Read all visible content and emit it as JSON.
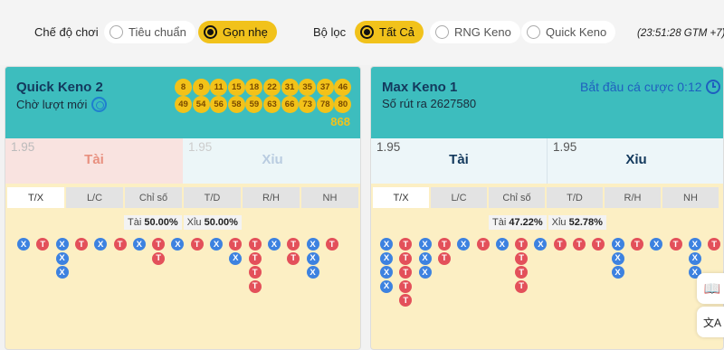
{
  "controls": {
    "mode_label": "Chế độ chơi",
    "modes": [
      {
        "label": "Tiêu chuẩn",
        "selected": false
      },
      {
        "label": "Gọn nhẹ",
        "selected": true
      }
    ],
    "filter_label": "Bộ lọc",
    "filters": [
      {
        "label": "Tất Cả",
        "selected": true
      },
      {
        "label": "RNG Keno",
        "selected": false
      },
      {
        "label": "Quick Keno",
        "selected": false
      }
    ],
    "clock": "(23:51:28 GTM +7)"
  },
  "cards": [
    {
      "title": "Quick Keno 2",
      "subtitle": "Chờ lượt mới",
      "balls": [
        "8",
        "9",
        "11",
        "15",
        "18",
        "22",
        "31",
        "35",
        "37",
        "46",
        "49",
        "54",
        "56",
        "58",
        "59",
        "63",
        "66",
        "73",
        "78",
        "80"
      ],
      "total": "868",
      "bets": [
        {
          "odds": "1.95",
          "name": "Tài"
        },
        {
          "odds": "1.95",
          "name": "Xỉu"
        }
      ],
      "tabs": [
        "T/X",
        "L/C",
        "Chỉ số",
        "T/D",
        "R/H",
        "NH"
      ],
      "active_tab": "T/X",
      "stats": {
        "tai_label": "Tài",
        "tai_value": "50.00%",
        "xiu_label": "Xỉu",
        "xiu_value": "50.00%"
      },
      "road": [
        [
          "X"
        ],
        [
          "T"
        ],
        [
          "X",
          "X",
          "X"
        ],
        [
          "T"
        ],
        [
          "X"
        ],
        [
          "T"
        ],
        [
          "X"
        ],
        [
          "T",
          "T"
        ],
        [
          "X"
        ],
        [
          "T"
        ],
        [
          "X"
        ],
        [
          "T",
          "X"
        ],
        [
          "T",
          "T",
          "T",
          "T"
        ],
        [
          "X"
        ],
        [
          "T",
          "T"
        ],
        [
          "X",
          "X",
          "X"
        ],
        [
          "T"
        ]
      ]
    },
    {
      "title": "Max Keno 1",
      "subtitle": "Số rút ra 2627580",
      "countdown": "Bắt đầu cá cược 0:12",
      "bets": [
        {
          "odds": "1.95",
          "name": "Tài"
        },
        {
          "odds": "1.95",
          "name": "Xỉu"
        }
      ],
      "tabs": [
        "T/X",
        "L/C",
        "Chỉ số",
        "T/D",
        "R/H",
        "NH"
      ],
      "active_tab": "T/X",
      "stats": {
        "tai_label": "Tài",
        "tai_value": "47.22%",
        "xiu_label": "Xỉu",
        "xiu_value": "52.78%"
      },
      "road": [
        [
          "X",
          "X",
          "X",
          "X"
        ],
        [
          "T",
          "T",
          "T",
          "T",
          "T"
        ],
        [
          "X",
          "X",
          "X"
        ],
        [
          "T",
          "T"
        ],
        [
          "X"
        ],
        [
          "T"
        ],
        [
          "X"
        ],
        [
          "T",
          "T",
          "T",
          "T"
        ],
        [
          "X"
        ],
        [
          "T"
        ],
        [
          "T"
        ],
        [
          "T"
        ],
        [
          "X",
          "X",
          "X"
        ],
        [
          "T"
        ],
        [
          "X"
        ],
        [
          "T"
        ],
        [
          "X",
          "X",
          "X"
        ],
        [
          "T"
        ]
      ]
    }
  ],
  "side_buttons": [
    {
      "icon": "book-icon",
      "glyph": "📖"
    },
    {
      "icon": "translate-icon",
      "glyph": "文A"
    }
  ]
}
